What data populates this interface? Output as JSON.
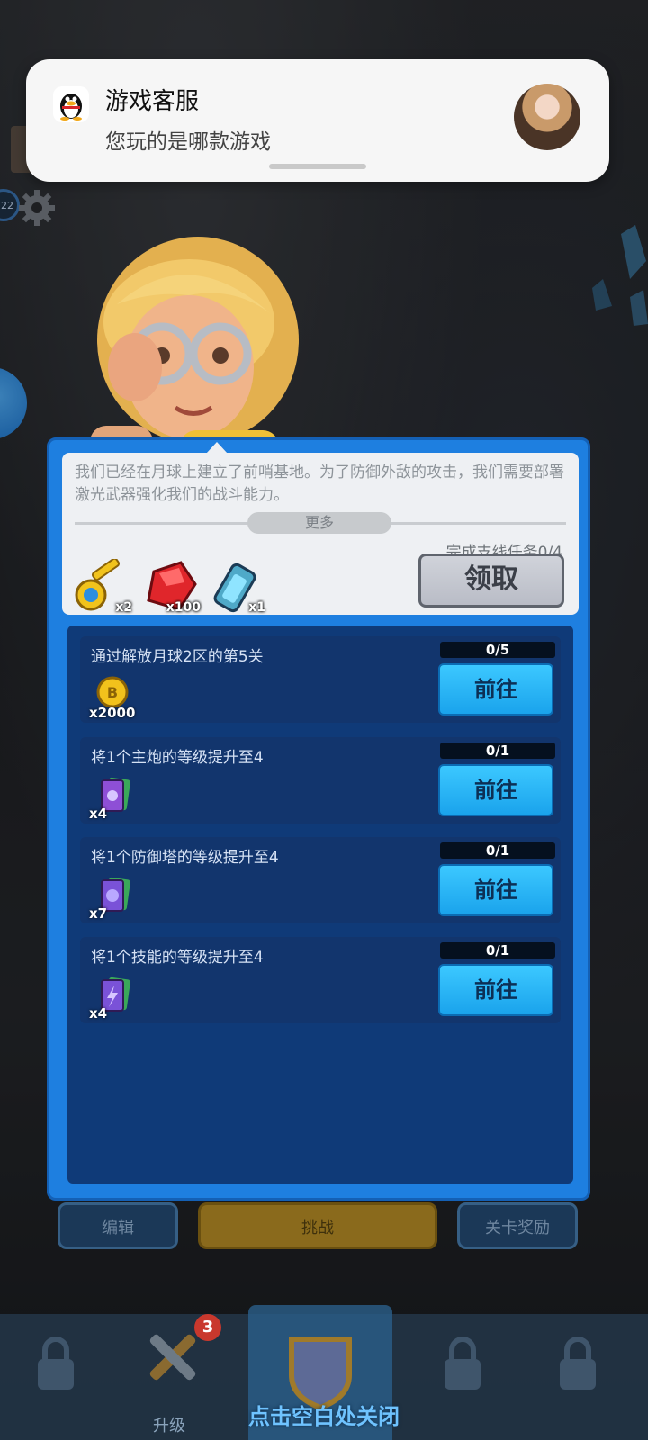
{
  "notification": {
    "title": "游戏客服",
    "message": "您玩的是哪款游戏"
  },
  "story": {
    "text": "我们已经在月球上建立了前哨基地。为了防御外敌的攻击，我们需要部署激光武器强化我们的战斗能力。",
    "more_label": "更多",
    "progress_label": "完成支线任务0/4",
    "claim_label": "领取",
    "rewards": [
      {
        "icon": "key-icon",
        "qty": "x2"
      },
      {
        "icon": "red-gem-icon",
        "qty": "x100"
      },
      {
        "icon": "battery-icon",
        "qty": "x1"
      }
    ]
  },
  "tasks": [
    {
      "title": "通过解放月球2区的第5关",
      "counter": "0/5",
      "button": "前往",
      "reward_icon": "gold-coin-icon",
      "reward_qty": "x2000"
    },
    {
      "title": "将1个主炮的等级提升至4",
      "counter": "0/1",
      "button": "前往",
      "reward_icon": "cannon-card-icon",
      "reward_qty": "x4"
    },
    {
      "title": "将1个防御塔的等级提升至4",
      "counter": "0/1",
      "button": "前往",
      "reward_icon": "tower-card-icon",
      "reward_qty": "x7"
    },
    {
      "title": "将1个技能的等级提升至4",
      "counter": "0/1",
      "button": "前往",
      "reward_icon": "skill-card-icon",
      "reward_qty": "x4"
    }
  ],
  "underlying": {
    "edit_label": "编辑",
    "challenge_label": "挑战",
    "level_rewards_label": "关卡奖励",
    "upgrade_label": "升级",
    "upgrade_badge": "3",
    "level_chip": "22"
  },
  "close_hint": "点击空白处关闭"
}
